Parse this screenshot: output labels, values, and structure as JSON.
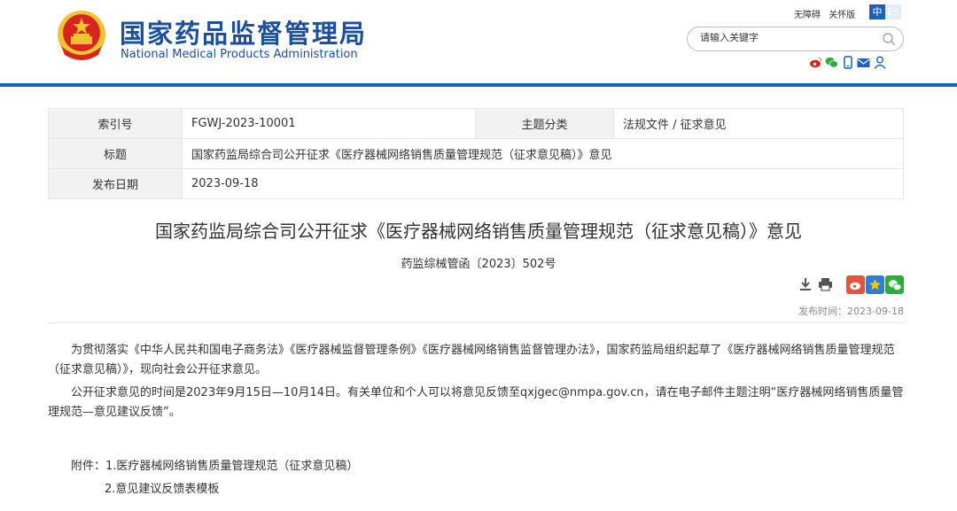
{
  "header": {
    "title_cn": "国家药品监督管理局",
    "title_en": "National Medical Products Administration",
    "accessibility_link": "无障碍",
    "care_mode_link": "关怀版",
    "lang_cn": "中",
    "lang_en": "En",
    "search_placeholder": "请输入关键字",
    "social_icons": [
      "weibo-icon",
      "wechat-icon",
      "mobile-icon",
      "mail-icon",
      "user-icon"
    ]
  },
  "meta": {
    "index_label": "索引号",
    "index_value": "FGWJ-2023-10001",
    "category_label": "主题分类",
    "category_value": "法规文件 / 征求意见",
    "title_label": "标题",
    "title_value": "国家药监局综合司公开征求《医疗器械网络销售质量管理规范（征求意见稿）》意见",
    "date_label": "发布日期",
    "date_value": "2023-09-18"
  },
  "article": {
    "title": "国家药监局综合司公开征求《医疗器械网络销售质量管理规范（征求意见稿）》意见",
    "doc_number": "药监综械管函〔2023〕502号",
    "publish_time": "发布时间：2023-09-18",
    "paragraph1": "为贯彻落实《中华人民共和国电子商务法》《医疗器械监督管理条例》《医疗器械网络销售监督管理办法》，国家药监局组织起草了《医疗器械网络销售质量管理规范（征求意见稿）》，现向社会公开征求意见。",
    "paragraph2": "公开征求意见的时间是2023年9月15日—10月14日。有关单位和个人可以将意见反馈至qxjgec@nmpa.gov.cn，请在电子邮件主题注明“医疗器械网络销售质量管理规范—意见建议反馈”。",
    "attachments_label": "附件：",
    "attachment1": "1.医疗器械网络销售质量管理规范（征求意见稿）",
    "attachment2": "2.意见建议反馈表模板"
  },
  "colors": {
    "brand_blue": "#1b4fa1",
    "bar_blue": "#1b5fbf",
    "emblem_red": "#d7261e",
    "emblem_gold": "#f2c230"
  }
}
